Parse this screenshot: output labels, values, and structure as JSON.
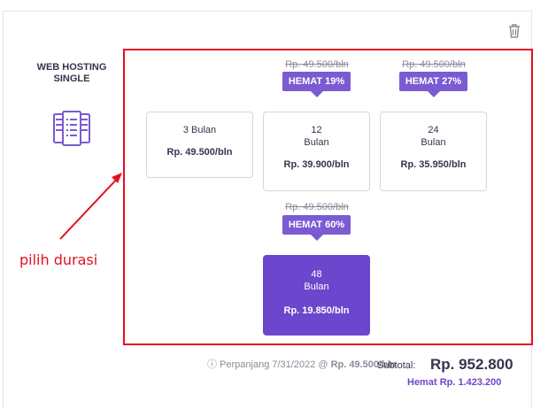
{
  "product": {
    "name": "WEB HOSTING SINGLE",
    "icon": "server-document-icon"
  },
  "options": [
    {
      "duration": "3 Bulan",
      "price": "Rp. 49.500/bln"
    },
    {
      "duration_num": "12",
      "duration_unit": "Bulan",
      "price": "Rp. 39.900/bln",
      "old_price": "Rp. 49.500/bln",
      "badge": "HEMAT 19%"
    },
    {
      "duration_num": "24",
      "duration_unit": "Bulan",
      "price": "Rp. 35.950/bln",
      "old_price": "Rp. 49.500/bln",
      "badge": "HEMAT 27%"
    },
    {
      "duration_num": "48",
      "duration_unit": "Bulan",
      "price": "Rp. 19.850/bln",
      "old_price": "Rp. 49.500/bln",
      "badge": "HEMAT 60%",
      "selected": true
    }
  ],
  "annotation": "pilih durasi",
  "renewal": {
    "prefix": "Perpanjang 7/31/2022 @",
    "price": "Rp. 49.500/bln"
  },
  "subtotal": {
    "label": "Subtotal:",
    "value": "Rp. 952.800"
  },
  "savings": {
    "label": "Hemat",
    "value": "Rp. 1.423.200"
  },
  "colors": {
    "accent": "#6c46cc",
    "badge": "#7a5bd2",
    "annotation": "#e3101f"
  }
}
